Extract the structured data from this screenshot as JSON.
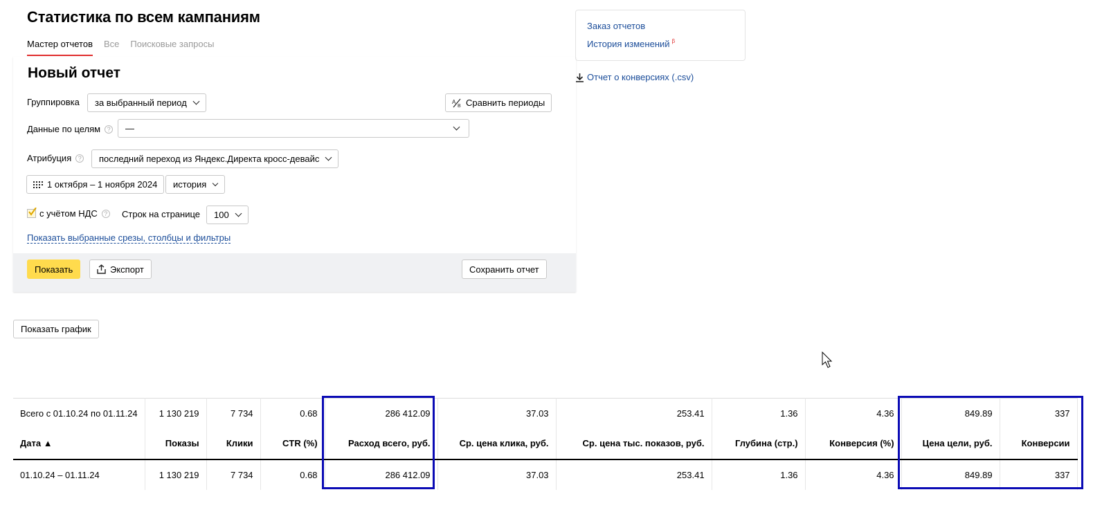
{
  "page": {
    "title": "Статистика по всем кампаниям"
  },
  "tabs": [
    {
      "label": "Мастер отчетов",
      "active": true
    },
    {
      "label": "Все",
      "active": false
    },
    {
      "label": "Поисковые запросы",
      "active": false
    }
  ],
  "report": {
    "title": "Новый отчет",
    "grouping": {
      "label": "Группировка",
      "value": "за выбранный период"
    },
    "compare_label": "Сравнить периоды",
    "goals": {
      "label": "Данные по целям",
      "value": "—"
    },
    "attribution": {
      "label": "Атрибуция",
      "value": "последний переход из Яндекс.Директа кросс-девайс"
    },
    "date_range": "1 октября – 1 ноября 2024",
    "history_select": "история",
    "vat": {
      "label": "с учётом НДС",
      "checked": true
    },
    "rows_per_page": {
      "label": "Строк на странице",
      "value": "100"
    },
    "show_filters_link": "Показать выбранные срезы, столбцы и фильтры",
    "show_button": "Показать",
    "export_button": "Экспорт",
    "save_button": "Сохранить отчет"
  },
  "side": {
    "order_reports": "Заказ отчетов",
    "change_history": "История изменений",
    "change_history_badge": "β",
    "conversions_csv": "Отчет о конверсиях (.csv)"
  },
  "show_chart_button": "Показать график",
  "table": {
    "total": [
      "Всего с 01.10.24 по 01.11.24",
      "1 130 219",
      "7 734",
      "0.68",
      "286 412.09",
      "37.03",
      "253.41",
      "1.36",
      "4.36",
      "849.89",
      "337"
    ],
    "headers": [
      "Дата ▲",
      "Показы",
      "Клики",
      "CTR (%)",
      "Расход всего, руб.",
      "Ср. цена клика, руб.",
      "Ср. цена тыс. показов, руб.",
      "Глубина (стр.)",
      "Конверсия (%)",
      "Цена цели, руб.",
      "Конверсии"
    ],
    "rows": [
      [
        "01.10.24 – 01.11.24",
        "1 130 219",
        "7 734",
        "0.68",
        "286 412.09",
        "37.03",
        "253.41",
        "1.36",
        "4.36",
        "849.89",
        "337"
      ]
    ]
  },
  "colors": {
    "accent_yellow": "#ffdb4d",
    "highlight_blue": "#0b0bb5",
    "tab_underline": "#e02c2c",
    "link": "#1a4c99"
  }
}
